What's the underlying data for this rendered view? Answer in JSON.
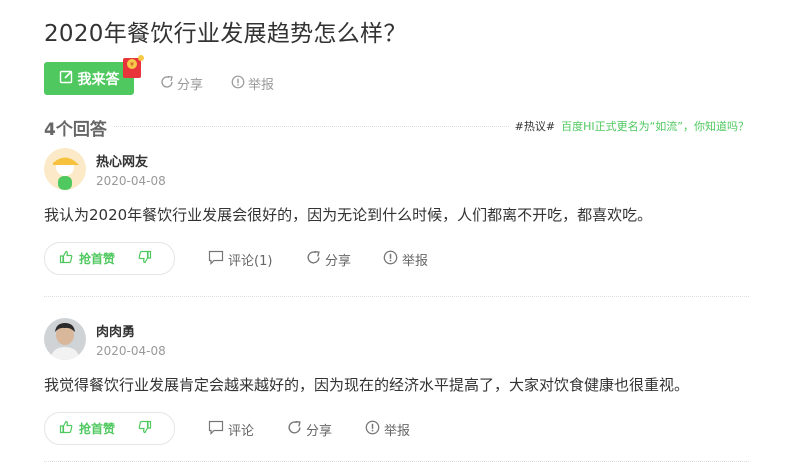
{
  "question": {
    "title": "2020年餐饮行业发展趋势怎么样？"
  },
  "toolbar": {
    "answer_label": "我来答",
    "share_label": "分享",
    "report_label": "举报"
  },
  "answers_header": {
    "count_label": "4个回答",
    "hot_tag": "#热议#",
    "hot_link": "百度HI正式更名为“如流”，你知道吗？"
  },
  "answers": [
    {
      "username": "热心网友",
      "date": "2020-04-08",
      "content": "我认为2020年餐饮行业发展会很好的，因为无论到什么时候，人们都离不开吃，都喜欢吃。",
      "like_label": "抢首赞",
      "comment_label": "评论(1)",
      "share_label": "分享",
      "report_label": "举报"
    },
    {
      "username": "肉肉勇",
      "date": "2020-04-08",
      "content": "我觉得餐饮行业发展肯定会越来越好的，因为现在的经济水平提高了，大家对饮食健康也很重视。",
      "like_label": "抢首赞",
      "comment_label": "评论",
      "share_label": "分享",
      "report_label": "举报"
    }
  ],
  "colors": {
    "accent": "#4fc85f",
    "muted": "#999999",
    "text": "#333333"
  }
}
